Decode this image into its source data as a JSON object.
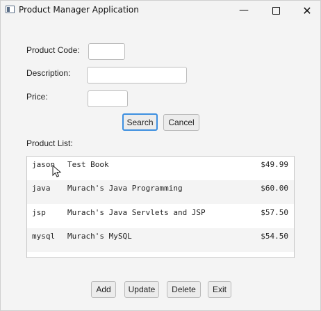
{
  "window": {
    "title": "Product Manager Application",
    "controls": {
      "minimize": "—",
      "close": "✕"
    }
  },
  "form": {
    "code_label": "Product Code:",
    "code_value": "",
    "description_label": "Description:",
    "description_value": "",
    "price_label": "Price:",
    "price_value": ""
  },
  "search_buttons": {
    "search": "Search",
    "cancel": "Cancel"
  },
  "product_list": {
    "label": "Product List:",
    "items": [
      {
        "code": "jason",
        "description": "Test Book",
        "price": "$49.99"
      },
      {
        "code": "java",
        "description": "Murach's Java Programming",
        "price": "$60.00"
      },
      {
        "code": "jsp",
        "description": "Murach's Java Servlets and JSP",
        "price": "$57.50"
      },
      {
        "code": "mysql",
        "description": "Murach's MySQL",
        "price": "$54.50"
      }
    ]
  },
  "action_buttons": {
    "add": "Add",
    "update": "Update",
    "delete": "Delete",
    "exit": "Exit"
  }
}
